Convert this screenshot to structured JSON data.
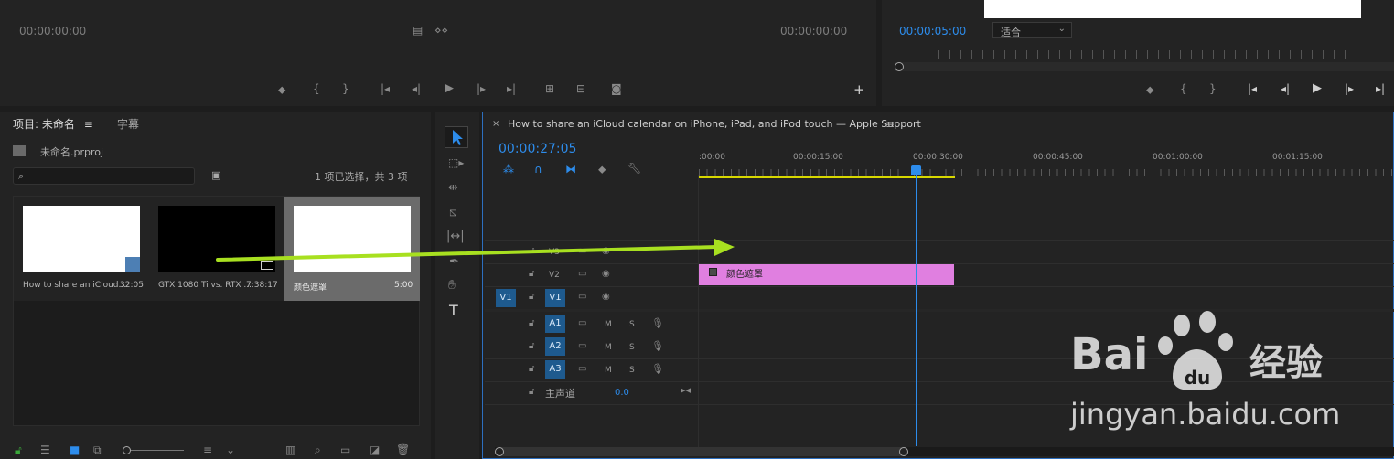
{
  "source_monitor": {
    "timecode_left": "00:00:00:00",
    "timecode_right": "00:00:00:00"
  },
  "program_monitor": {
    "timecode": "00:00:05:00",
    "fit_label": "适合"
  },
  "project": {
    "tab_label": "项目: 未命名",
    "captions_tab": "字幕",
    "file_name": "未命名.prproj",
    "search_placeholder": "",
    "selection_status": "1 项已选择，共 3 项",
    "items": [
      {
        "name": "How to share an iCloud...",
        "duration": "32:05"
      },
      {
        "name": "GTX 1080 Ti vs. RTX ...",
        "duration": "7:38:17"
      },
      {
        "name": "颜色遮罩",
        "duration": "5:00"
      }
    ]
  },
  "timeline": {
    "sequence_name": "How to share an iCloud calendar on iPhone, iPad, and iPod touch — Apple Support",
    "timecode": "00:00:27:05",
    "ruler": [
      ":00:00",
      "00:00:15:00",
      "00:00:30:00",
      "00:00:45:00",
      "00:01:00:00",
      "00:01:15:00"
    ],
    "tracks": {
      "v3": "V3",
      "v2": "V2",
      "v1": "V1",
      "v1_source": "V1",
      "a1": "A1",
      "a2": "A2",
      "a3": "A3",
      "mute": "M",
      "solo": "S",
      "master": "主声道",
      "master_value": "0.0"
    },
    "clip_label": "颜色遮罩",
    "clip_color": "#e07fe0"
  },
  "watermark": {
    "brand": "Bai",
    "brand_tail": "经验",
    "url": "jingyan.baidu.com"
  }
}
